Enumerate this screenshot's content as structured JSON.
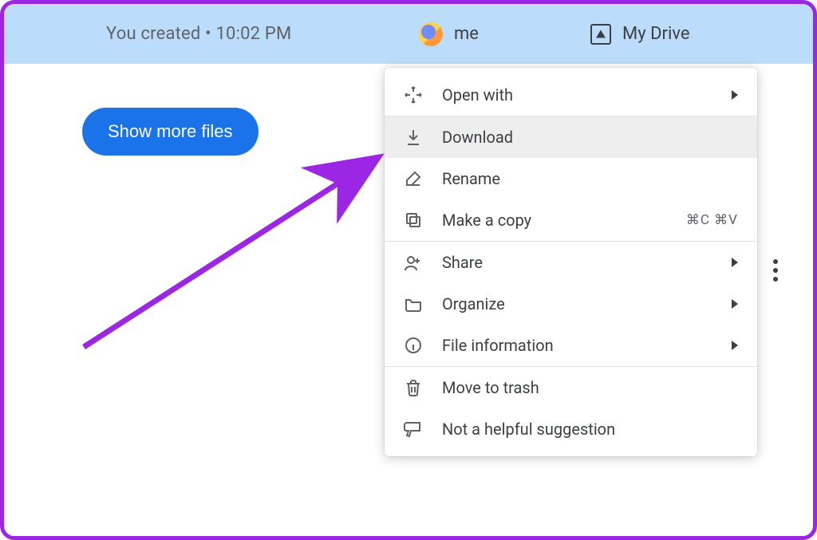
{
  "topbar": {
    "created_text": "You created • 10:02 PM",
    "owner_label": "me",
    "location_label": "My Drive"
  },
  "buttons": {
    "show_more": "Show more files"
  },
  "menu": {
    "open_with": "Open with",
    "download": "Download",
    "rename": "Rename",
    "make_copy": "Make a copy",
    "make_copy_shortcut": "⌘C ⌘V",
    "share": "Share",
    "organize": "Organize",
    "file_info": "File information",
    "move_to_trash": "Move to trash",
    "not_helpful": "Not a helpful suggestion"
  }
}
